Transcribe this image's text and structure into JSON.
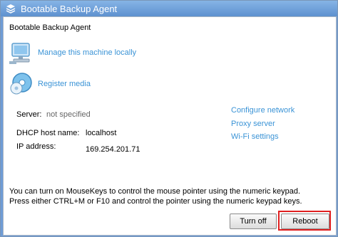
{
  "window": {
    "title": "Bootable Backup Agent"
  },
  "main": {
    "header": "Bootable Backup Agent",
    "links": {
      "manage": "Manage this machine locally",
      "register": "Register media"
    },
    "info": {
      "server_label": "Server:",
      "server_value": "not specified",
      "dhcp_label": "DHCP host name:",
      "dhcp_value": "localhost",
      "ip_label": "IP address:",
      "ip_value": "169.254.201.71"
    },
    "right_links": {
      "configure_network": "Configure network",
      "proxy_server": "Proxy server",
      "wifi_settings": "Wi-Fi settings"
    },
    "note_line1": "You can turn on MouseKeys to control the mouse pointer using the numeric keypad.",
    "note_line2": "Press either CTRL+M or F10 and control the pointer using the numeric keypad keys."
  },
  "buttons": {
    "turn_off": "Turn off",
    "reboot": "Reboot"
  },
  "colors": {
    "link": "#3a93d6",
    "titlebar": "#6f9cd6",
    "highlight": "#e02020"
  },
  "icons": {
    "app": "layers-icon",
    "manage": "computer-icon",
    "register": "media-disc-icon"
  }
}
